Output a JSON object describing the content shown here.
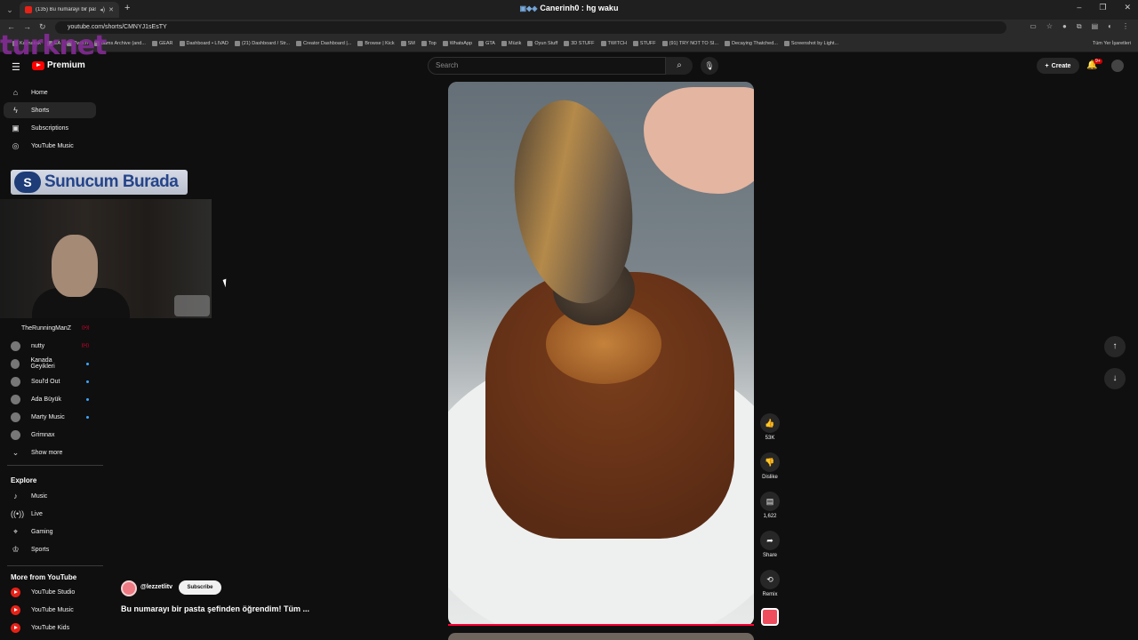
{
  "browser": {
    "tab_title": "(135) Bu numarayı bir pasta...",
    "window_title": "Canerinh0 : hg waku",
    "url": "youtube.com/shorts/CMNYJ1sEsTY",
    "bookmarks": [
      "Kaynakkk",
      "EA",
      "Twitch",
      "dams Archive (and...",
      "GEAR",
      "Dashboard • LIVAD",
      "(21) Dashboard / Str...",
      "Creator Dashboard |...",
      "Browse | Kick",
      "SM",
      "Top",
      "WhatsApp",
      "GTA",
      "Müzik",
      "Oyun Stuff",
      "3D STUFF",
      "TWITCH",
      "STUFF",
      "(91) TRY NOT TO SI...",
      "Decaying Thatched...",
      "Screenshot by Light..."
    ],
    "bookmarks_right": "Tüm Yer İşaretleri"
  },
  "watermark": "turknet",
  "youtube": {
    "logo_text": "Premium",
    "search_placeholder": "Search",
    "create_label": "Create",
    "notif_count": "9+"
  },
  "sidebar": {
    "main": [
      {
        "label": "Home",
        "icon": "home-icon",
        "glyph": "⌂"
      },
      {
        "label": "Shorts",
        "icon": "shorts-icon",
        "glyph": "ϟ",
        "active": true
      },
      {
        "label": "Subscriptions",
        "icon": "subscriptions-icon",
        "glyph": "▣"
      },
      {
        "label": "YouTube Music",
        "icon": "music-circle-icon",
        "glyph": "◎"
      }
    ],
    "subscriptions": [
      {
        "label": "TheRunningManZ",
        "live": true
      },
      {
        "label": "nutty",
        "live": true
      },
      {
        "label": "Kanada Geyikleri",
        "new": true
      },
      {
        "label": "Soul'd Out",
        "new": true
      },
      {
        "label": "Ada Büyük",
        "new": true
      },
      {
        "label": "Marty Music",
        "new": true
      },
      {
        "label": "Grimnax"
      }
    ],
    "show_more": "Show more",
    "explore_title": "Explore",
    "explore": [
      {
        "label": "Music",
        "glyph": "♪",
        "icon": "music-note-icon"
      },
      {
        "label": "Live",
        "glyph": "((•))",
        "icon": "live-icon"
      },
      {
        "label": "Gaming",
        "glyph": "⌖",
        "icon": "gaming-icon"
      },
      {
        "label": "Sports",
        "glyph": "♔",
        "icon": "trophy-icon"
      }
    ],
    "more_title": "More from YouTube",
    "more": [
      "YouTube Studio",
      "YouTube Music",
      "YouTube Kids"
    ]
  },
  "overlay": {
    "sponsor_text": "Sunucum Burada",
    "sponsor_logo": "S"
  },
  "short": {
    "channel": "@lezzetlitv",
    "subscribe_label": "Subscribe",
    "caption": "Bu numarayı bir pasta şefinden öğrendim! Tüm ...",
    "likes": "53K",
    "dislike_label": "Dislike",
    "comments": "1,622",
    "share_label": "Share",
    "remix_label": "Remix"
  }
}
